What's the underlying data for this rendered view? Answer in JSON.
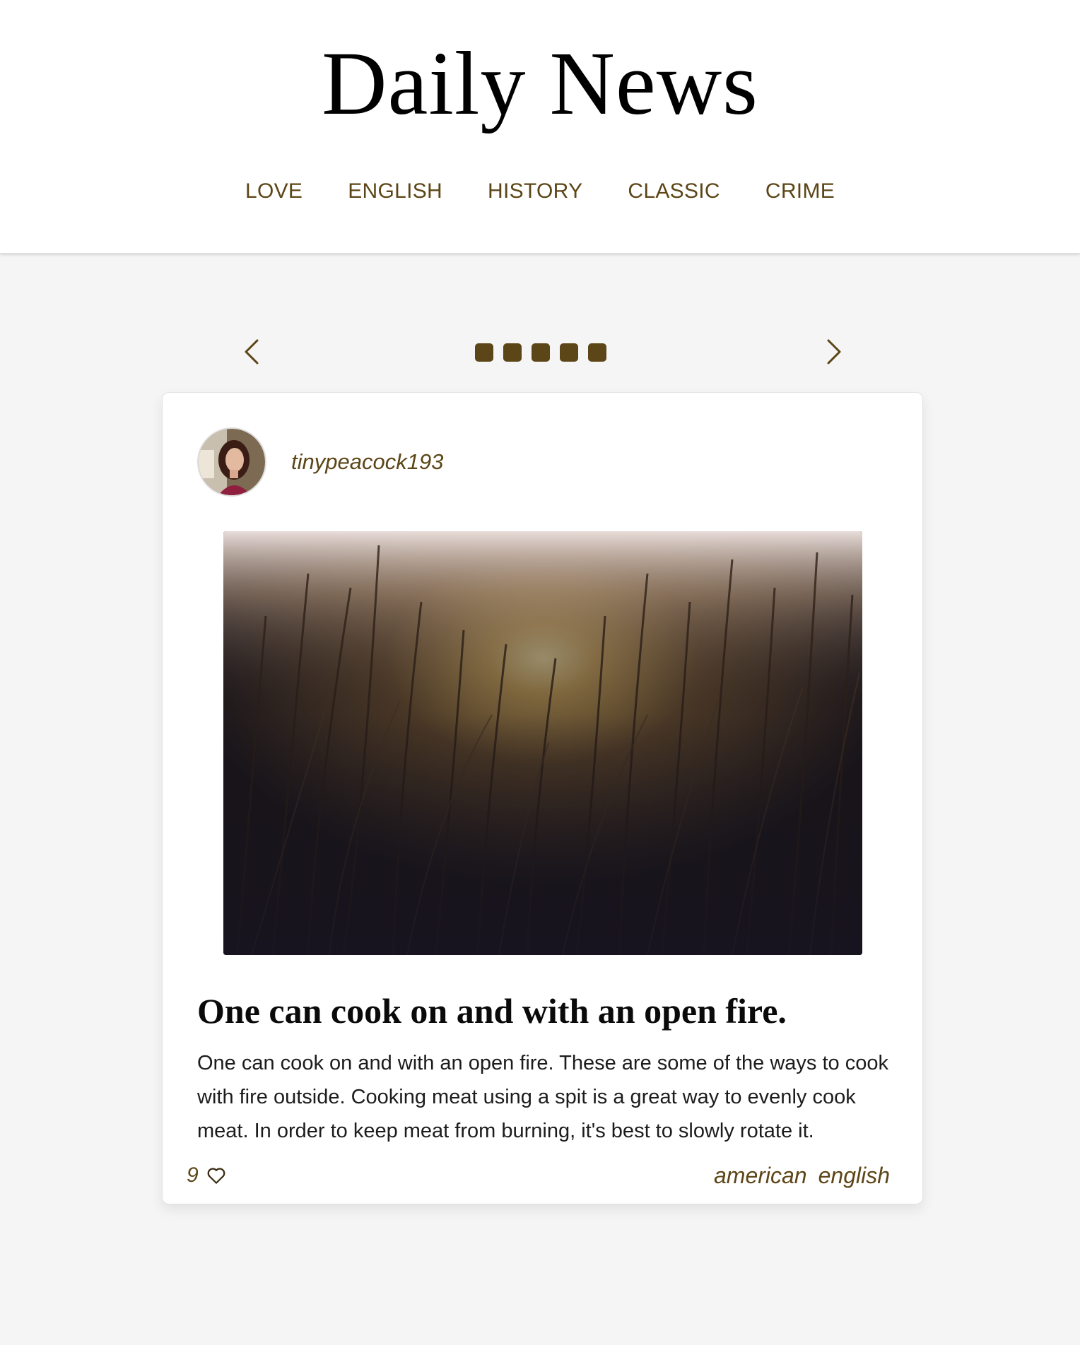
{
  "site": {
    "title": "Daily News"
  },
  "nav": {
    "items": [
      {
        "label": "LOVE"
      },
      {
        "label": "ENGLISH"
      },
      {
        "label": "HISTORY"
      },
      {
        "label": "CLASSIC"
      },
      {
        "label": "CRIME"
      }
    ]
  },
  "carousel": {
    "slide_count": 5,
    "prev_icon": "chevron-left-icon",
    "next_icon": "chevron-right-icon"
  },
  "post": {
    "author": "tinypeacock193",
    "image_description_icon": "photo",
    "title": "One can cook on and with an open fire.",
    "body": "One can cook on and with an open fire. These are some of the ways to cook with fire outside. Cooking meat using a spit is a great way to evenly cook meat. In order to keep meat from burning, it's best to slowly rotate it.",
    "likes": "9",
    "tags": [
      "american",
      "english"
    ]
  },
  "colors": {
    "accent": "#5c4516",
    "background": "#f5f5f5",
    "surface": "#ffffff"
  }
}
